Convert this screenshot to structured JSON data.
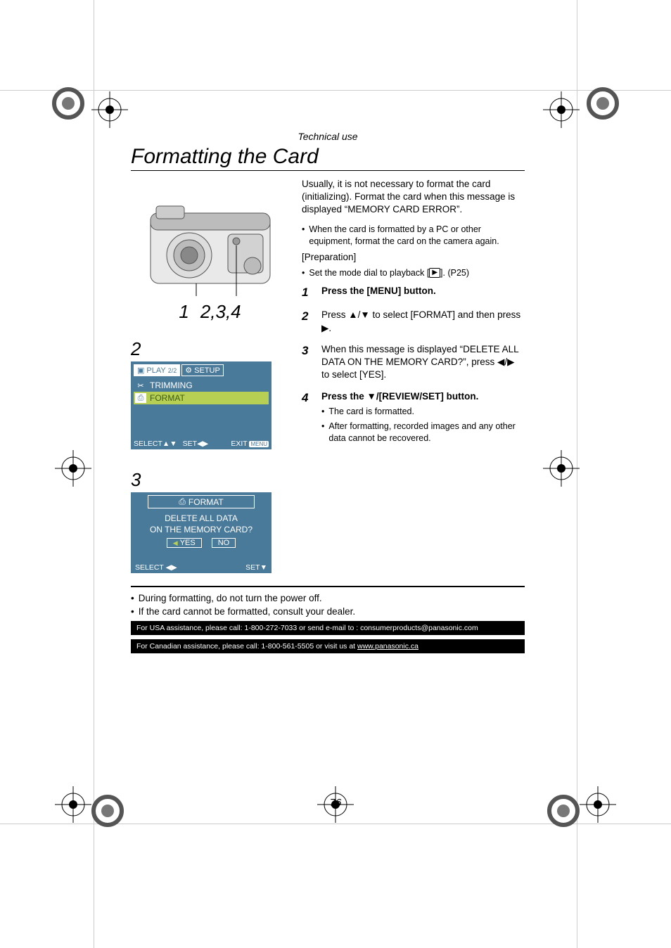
{
  "header": {
    "section": "Technical use",
    "title": "Formatting the Card"
  },
  "camera_callouts": {
    "a": "1",
    "b": "2,3,4"
  },
  "screen2": {
    "step_label": "2",
    "tab_play": "PLAY",
    "tab_play_page": "2/2",
    "tab_setup": "SETUP",
    "item_trimming": "TRIMMING",
    "item_format": "FORMAT",
    "footer_select": "SELECT",
    "footer_set": "SET",
    "footer_exit": "EXIT",
    "footer_menu_badge": "MENU"
  },
  "screen3": {
    "step_label": "3",
    "title": "FORMAT",
    "line1": "DELETE ALL DATA",
    "line2": "ON THE MEMORY CARD?",
    "yes": "YES",
    "no": "NO",
    "footer_select": "SELECT",
    "footer_set": "SET"
  },
  "intro": "Usually, it is not necessary to format the card (initializing). Format the card when this message is displayed “MEMORY CARD ERROR”.",
  "note1": "When the card is formatted by a PC or other equipment, format the card on the camera again.",
  "prep_label": "[Preparation]",
  "prep_item": "Set the mode dial to playback [",
  "prep_item_tail": "]. (P25)",
  "play_glyph": "▶",
  "steps": {
    "s1": {
      "num": "1",
      "text": "Press the [MENU] button."
    },
    "s2": {
      "num": "2",
      "pre": "Press ",
      "mid": " to select [FORMAT] and then press ",
      "post": "."
    },
    "s3": {
      "num": "3",
      "pre": "When this message is displayed “DELETE ALL DATA ON THE MEMORY CARD?”, press ",
      "post": " to select [YES]."
    },
    "s4": {
      "num": "4",
      "pre": "Press the ",
      "mid": "/[REVIEW/SET] button.",
      "b1": "The card is formatted.",
      "b2": "After formatting, recorded images and any other data cannot be recovered."
    }
  },
  "glyphs": {
    "updown": "▲/▼",
    "right": "▶",
    "leftright": "◀/▶",
    "down": "▼",
    "up": "▲",
    "tri_updown": "△▽"
  },
  "bottom": {
    "b1": "During formatting, do not turn the power off.",
    "b2": "If the card cannot be formatted, consult your dealer."
  },
  "assist": {
    "usa": "For USA assistance, please call: 1-800-272-7033 or send e-mail to : consumerproducts@panasonic.com",
    "can_pre": "For Canadian assistance, please call: 1-800-561-5505 or visit us at ",
    "can_link": "www.panasonic.ca"
  },
  "page_number": "76"
}
